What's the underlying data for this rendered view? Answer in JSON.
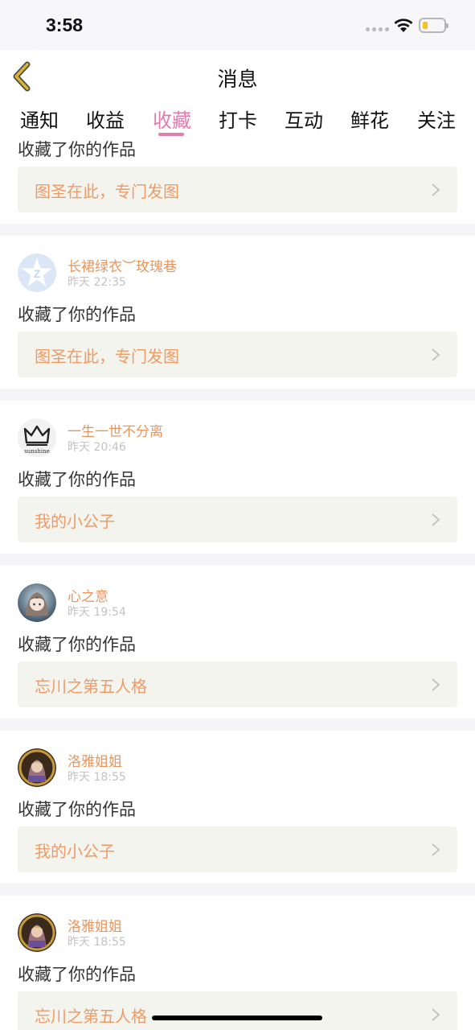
{
  "status_bar": {
    "time": "3:58"
  },
  "navbar": {
    "title": "消息"
  },
  "tabs": [
    {
      "label": "通知",
      "active": false
    },
    {
      "label": "收益",
      "active": false
    },
    {
      "label": "收藏",
      "active": true
    },
    {
      "label": "打卡",
      "active": false
    },
    {
      "label": "互动",
      "active": false
    },
    {
      "label": "鲜花",
      "active": false
    },
    {
      "label": "关注",
      "active": false
    }
  ],
  "items": [
    {
      "action": "收藏了你的作品",
      "work_title": "图圣在此，专门发图"
    },
    {
      "user": "长裙绿衣︶玫瑰巷",
      "time": "昨天 22:35",
      "action": "收藏了你的作品",
      "work_title": "图圣在此，专门发图",
      "avatar": "qq-default-avatar"
    },
    {
      "user": "一生一世不分离",
      "time": "昨天 20:46",
      "action": "收藏了你的作品",
      "work_title": "我的小公子",
      "avatar": "crown-avatar",
      "avatar_text": "sunshine"
    },
    {
      "user": "心之意",
      "time": "昨天 19:54",
      "action": "收藏了你的作品",
      "work_title": "忘川之第五人格",
      "avatar": "anime-girl-avatar"
    },
    {
      "user": "洛雅姐姐",
      "time": "昨天 18:55",
      "action": "收藏了你的作品",
      "work_title": "我的小公子",
      "avatar": "portrait-avatar"
    },
    {
      "user": "洛雅姐姐",
      "time": "昨天 18:55",
      "action": "收藏了你的作品",
      "work_title": "忘川之第五人格",
      "avatar": "portrait-avatar"
    }
  ],
  "colors": {
    "accent_pink": "#e27cae",
    "username_orange": "#e9965e",
    "work_title_orange": "#ee9b66",
    "work_bg": "#f4f4ee",
    "back_chevron": "#d4b53a"
  }
}
